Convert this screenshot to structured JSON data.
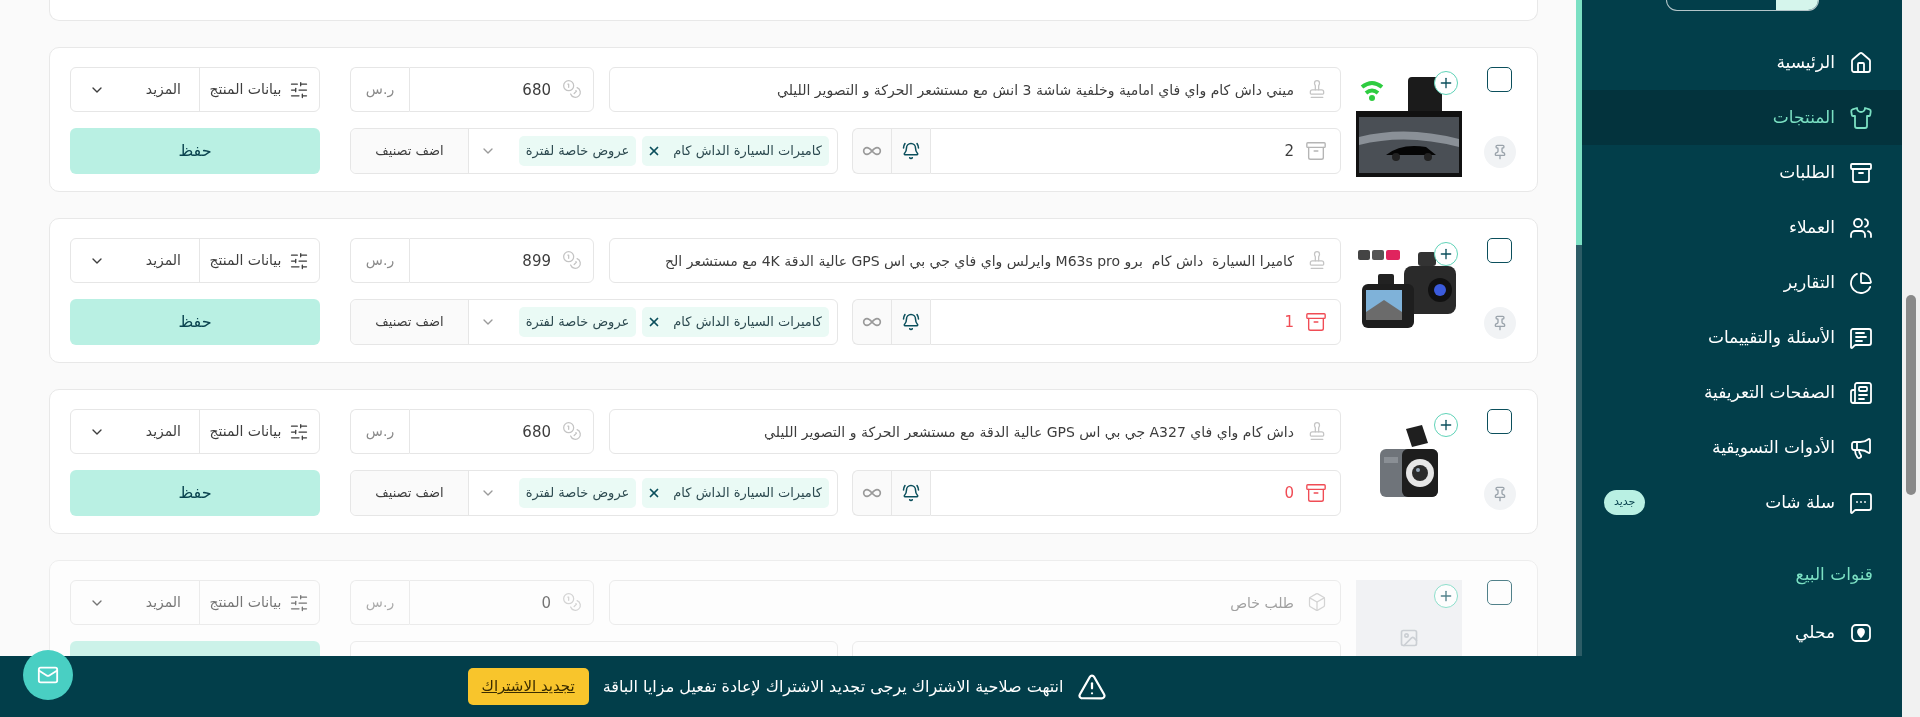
{
  "sidebar": {
    "menu": [
      {
        "label": "الرئيسية",
        "selected": false
      },
      {
        "label": "المنتجات",
        "selected": true
      },
      {
        "label": "الطلبات",
        "selected": false
      },
      {
        "label": "العملاء",
        "selected": false
      },
      {
        "label": "التقارير",
        "selected": false
      },
      {
        "label": "الأسئلة والتقييمات",
        "selected": false
      },
      {
        "label": "الصفحات التعريفية",
        "selected": false
      },
      {
        "label": "الأدوات التسويقية",
        "selected": false
      },
      {
        "label": "سلة شات",
        "selected": false,
        "badge": "جديد"
      }
    ],
    "sections": [
      {
        "title": "قنوات البيع",
        "items": [
          {
            "label": "محلي",
            "selected": false
          }
        ]
      }
    ]
  },
  "products": [
    {
      "name": "ميني داش كام واي فاي امامية وخلفية شاشة 3 انش مع مستشعر الحركة و التصوير الليلي",
      "price": "680",
      "currency": "ر.س",
      "stock": "2",
      "stock_alert": false,
      "tags": [
        {
          "label": "كاميرات السيارة الداش كام",
          "removable": true
        },
        {
          "label": "عروض خاصة لفترة",
          "removable": false
        }
      ],
      "add_category": "اضف تصنيف",
      "details_label": "بيانات المنتج",
      "more_label": "المزيد",
      "save_label": "حفظ",
      "checked": false,
      "disabled": false,
      "has_image": true
    },
    {
      "name": "كاميرا السيارة  داش كام  برو M63s pro وايرلس واي فاي جي بي اس GPS عالية الدقة 4K مع مستشعر الح",
      "price": "899",
      "currency": "ر.س",
      "stock": "1",
      "stock_alert": true,
      "tags": [
        {
          "label": "كاميرات السيارة الداش كام",
          "removable": true
        },
        {
          "label": "عروض خاصة لفترة",
          "removable": false
        }
      ],
      "add_category": "اضف تصنيف",
      "details_label": "بيانات المنتج",
      "more_label": "المزيد",
      "save_label": "حفظ",
      "checked": false,
      "disabled": false,
      "has_image": true
    },
    {
      "name": "داش كام واي فاي A327 جي بي اس GPS عالية الدقة مع مستشعر الحركة و التصوير الليلي",
      "price": "680",
      "currency": "ر.س",
      "stock": "0",
      "stock_alert": true,
      "tags": [
        {
          "label": "كاميرات السيارة الداش كام",
          "removable": true
        },
        {
          "label": "عروض خاصة لفترة",
          "removable": false
        }
      ],
      "add_category": "اضف تصنيف",
      "details_label": "بيانات المنتج",
      "more_label": "المزيد",
      "save_label": "حفظ",
      "checked": false,
      "disabled": false,
      "has_image": true
    },
    {
      "name_placeholder": "طلب خاص",
      "price": "0",
      "currency": "ر.س",
      "details_label": "بيانات المنتج",
      "more_label": "المزيد",
      "checked": false,
      "disabled": true,
      "has_image": false
    }
  ],
  "banner": {
    "message": "انتهت صلاحية الاشتراك يرجى تجديد الاشتراك لإعادة تفعيل مزايا الباقة",
    "button": "تجديد الاشتراك"
  }
}
